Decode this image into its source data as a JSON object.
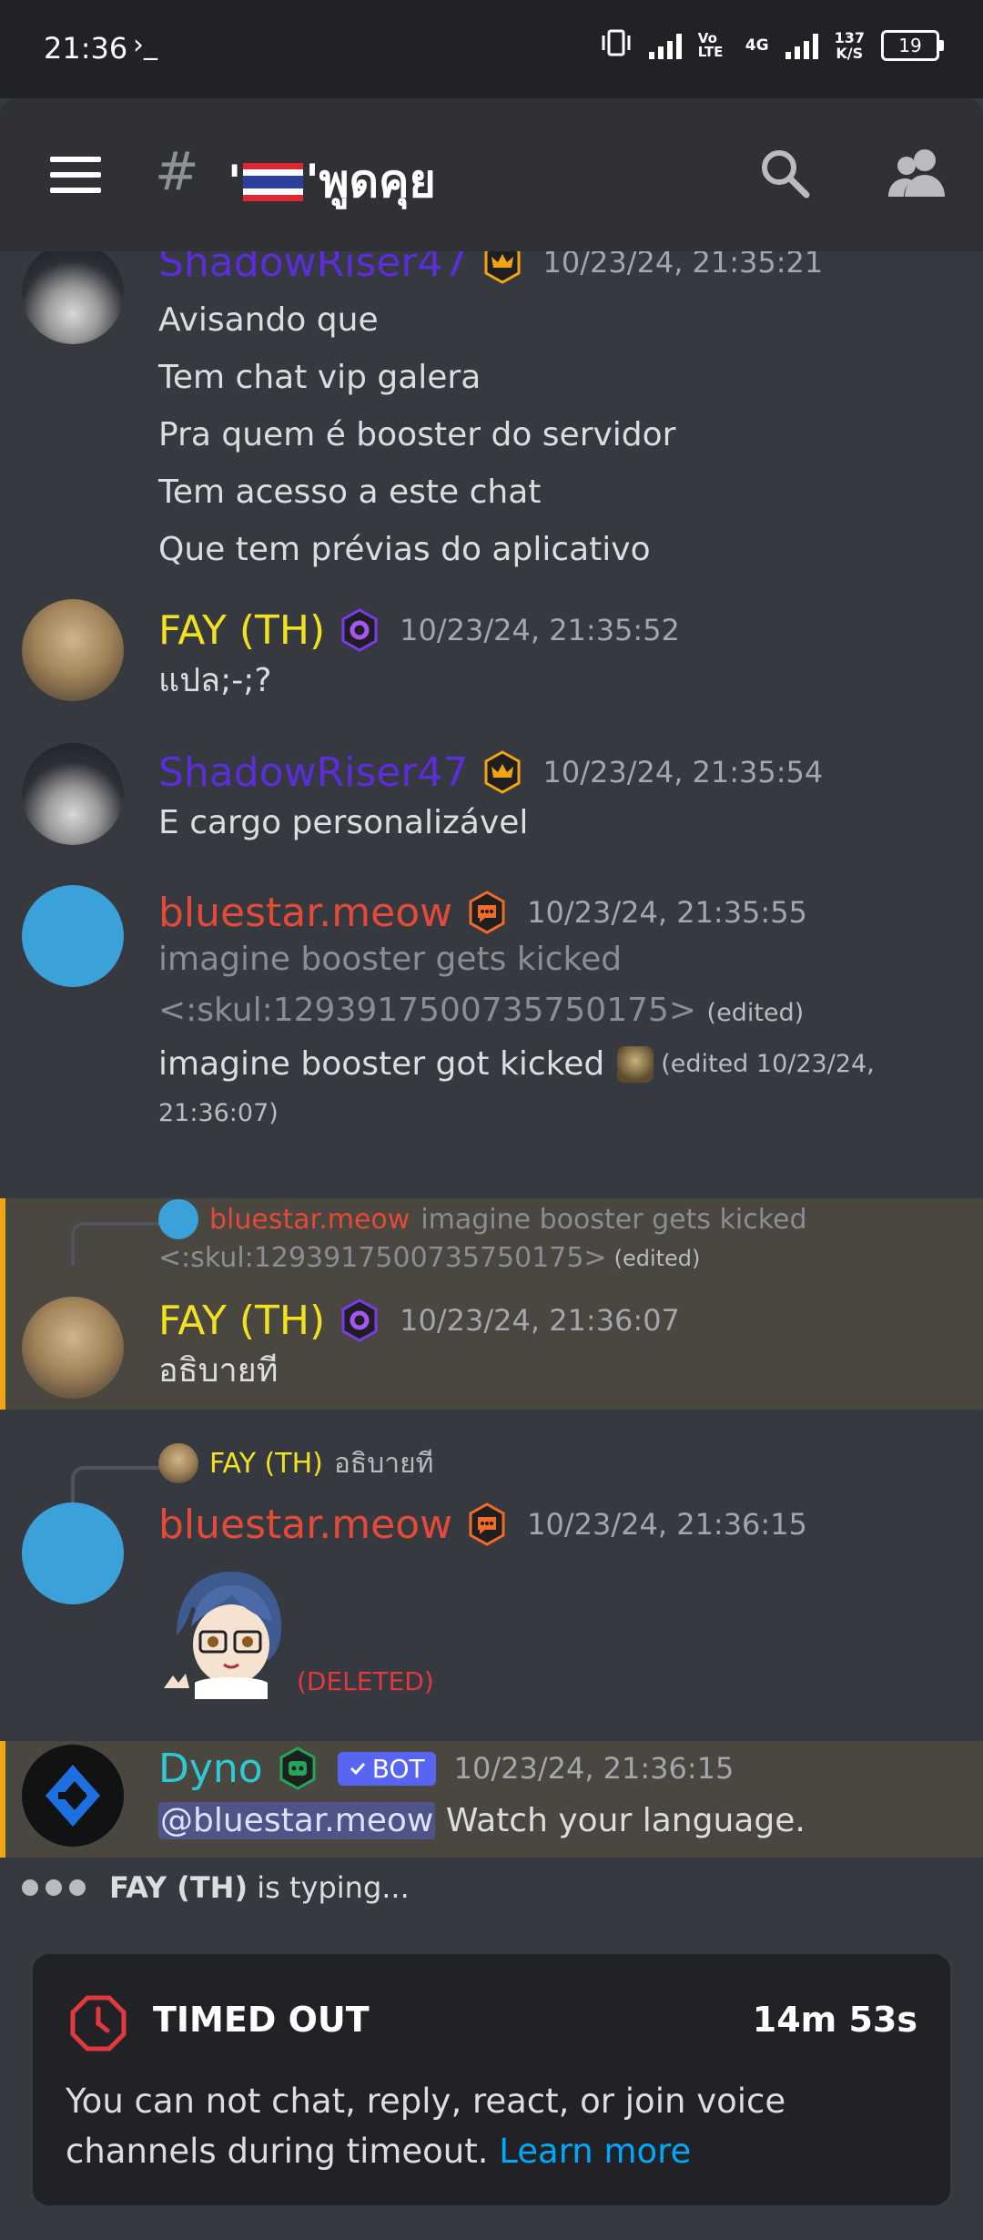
{
  "status_bar": {
    "time": "21:36",
    "prompt": "›_",
    "net_speed": "137",
    "net_unit": "K/S",
    "battery": "19",
    "volte": "Vo LTE",
    "network": "4G"
  },
  "header": {
    "channel_name": "'🇹🇭'พูดคุย",
    "channel_prefix": "'",
    "channel_suffix": "'พูดคุย"
  },
  "messages": [
    {
      "author": "ShadowRiser47",
      "time": "10/23/24, 21:35:21",
      "lines": [
        "Avisando que",
        "Tem chat vip galera",
        "Pra quem é booster do servidor",
        "Tem acesso a este chat",
        "Que tem prévias do aplicativo"
      ]
    },
    {
      "author": "FAY (TH)",
      "time": "10/23/24, 21:35:52",
      "text": "แปล;-;?"
    },
    {
      "author": "ShadowRiser47",
      "time": "10/23/24, 21:35:54",
      "text": "E cargo personalizável"
    },
    {
      "author": "bluestar.meow",
      "time": "10/23/24, 21:35:55",
      "old_line1": "imagine booster gets kicked",
      "old_line2": "<:skul:1293917500735750175>",
      "edited_tag": "(edited)",
      "new_text": "imagine booster got kicked",
      "edited_tag2": "(edited 10/23/24,",
      "edited_time2": "21:36:07)"
    },
    {
      "author": "FAY (TH)",
      "time": "10/23/24, 21:36:07",
      "text": "อธิบายที",
      "reply_author": "bluestar.meow",
      "reply_line1": "imagine booster gets kicked",
      "reply_line2": "<:skul:1293917500735750175>",
      "reply_edited": "(edited)"
    },
    {
      "author": "bluestar.meow",
      "time": "10/23/24, 21:36:15",
      "deleted": "(DELETED)",
      "reply_author": "FAY (TH)",
      "reply_text": "อธิบายที"
    },
    {
      "author": "Dyno",
      "bot_tag": "BOT",
      "time": "10/23/24, 21:36:15",
      "mention": "@bluestar.meow",
      "text": "Watch your language."
    }
  ],
  "typing": {
    "user": "FAY (TH)",
    "suffix": " is typing..."
  },
  "timeout": {
    "title": "TIMED OUT",
    "remaining": "14m 53s",
    "description": "You can not chat, reply, react, or join voice channels during timeout.",
    "link": "Learn more"
  },
  "colors": {
    "accent_link": "#00a8fc",
    "timeout_red": "#e2393f",
    "highlight_bar": "#f0a313",
    "bot_badge": "#5865f2"
  }
}
